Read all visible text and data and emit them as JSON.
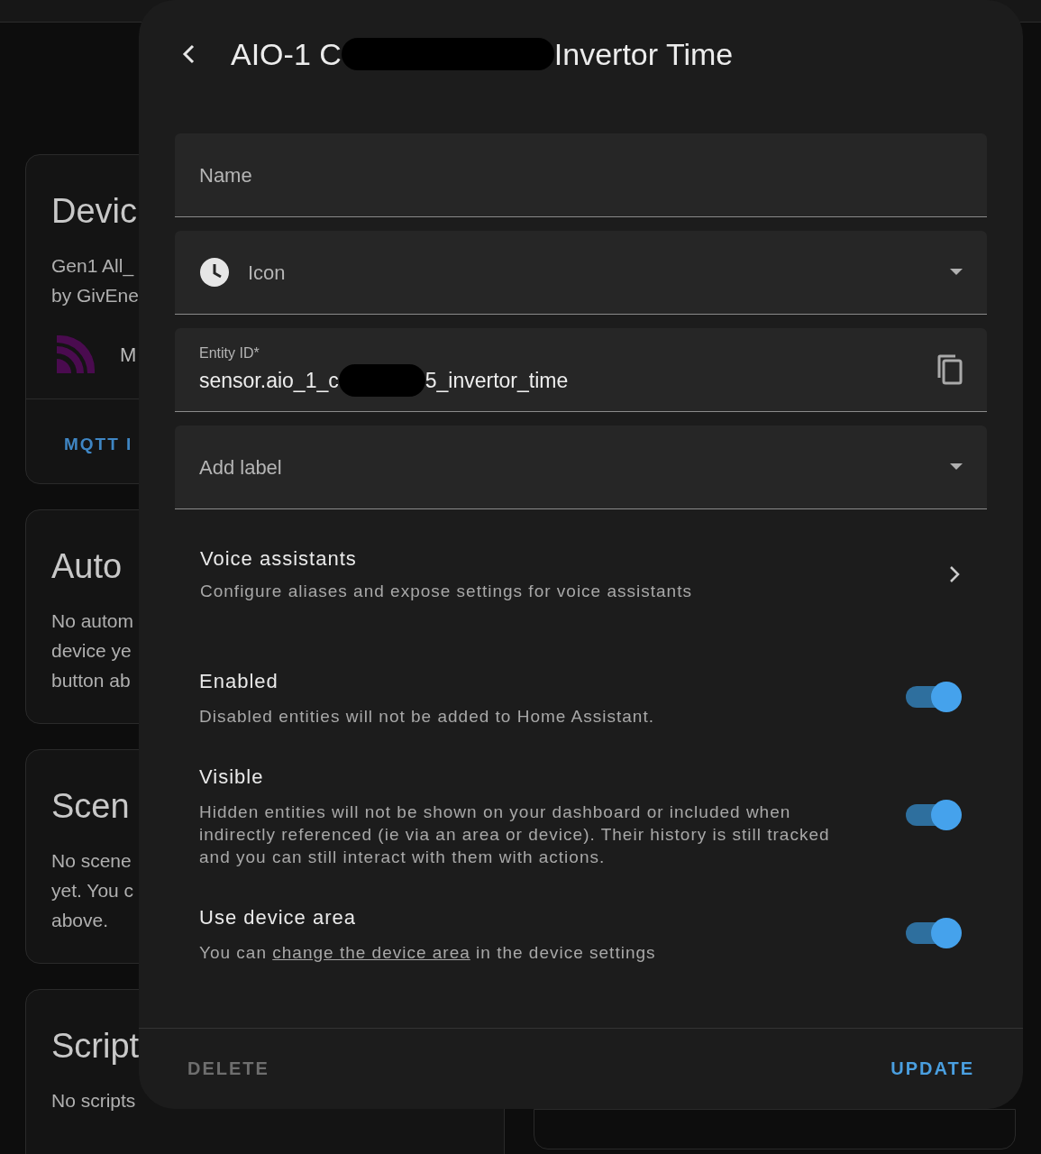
{
  "background_cards": [
    {
      "title": "Devic",
      "lines": [
        "Gen1 All_",
        "by GivEne"
      ],
      "integration": {
        "label": "M"
      },
      "action": "MQTT I"
    },
    {
      "title": "Auto",
      "lines": [
        "No autom",
        "device ye",
        "button ab"
      ]
    },
    {
      "title": "Scen",
      "lines": [
        "No scene",
        "yet. You c",
        "above."
      ]
    },
    {
      "title": "Script",
      "lines": [
        "No scripts"
      ]
    }
  ],
  "dialog": {
    "title_start": "AIO-1 C",
    "title_end": "Invertor Time",
    "fields": [
      {
        "kind": "text",
        "placeholder": "Name"
      },
      {
        "kind": "icon",
        "placeholder": "Icon"
      },
      {
        "kind": "entity",
        "label": "Entity ID*",
        "value_start": "sensor.aio_1_c",
        "value_end": "5_invertor_time"
      },
      {
        "kind": "select",
        "placeholder": "Add label"
      }
    ],
    "voice": {
      "title": "Voice assistants",
      "description": "Configure aliases and expose settings for voice assistants"
    },
    "toggles": [
      {
        "title": "Enabled",
        "description": "Disabled entities will not be added to Home Assistant.",
        "on": true
      },
      {
        "title": "Visible",
        "description": "Hidden entities will not be shown on your dashboard or included when indirectly referenced (ie via an area or device). Their history is still tracked and you can still interact with them with actions.",
        "on": true
      },
      {
        "title": "Use device area",
        "description_before": "You can",
        "link": "change the device area",
        "description_after": "in the device settings",
        "on": true
      }
    ],
    "buttons": [
      {
        "label": "DELETE",
        "kind": "secondary"
      },
      {
        "label": "UPDATE",
        "kind": "primary"
      }
    ]
  }
}
